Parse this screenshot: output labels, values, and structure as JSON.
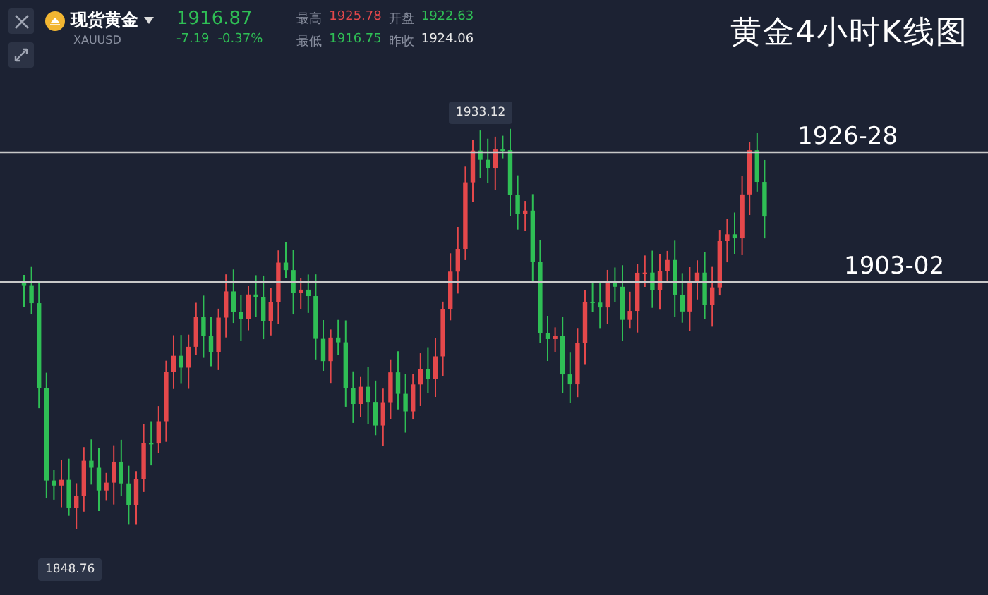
{
  "instrument": {
    "name": "现货黄金",
    "symbol": "XAUUSD",
    "price": "1916.87",
    "change": "-7.19",
    "change_percent": "-0.37%",
    "kind": "down",
    "stats": [
      {
        "label": "最高",
        "value": "1925.78",
        "kind": "up"
      },
      {
        "label": "开盘",
        "value": "1922.63",
        "kind": "down"
      },
      {
        "label": "最低",
        "value": "1916.75",
        "kind": "down"
      },
      {
        "label": "昨收",
        "value": "1924.06",
        "kind": "neutral"
      }
    ]
  },
  "title": "黄金4小时K线图",
  "chart": {
    "high_label": "1933.12",
    "low_label": "1848.76",
    "levels": [
      {
        "label": "1926-28"
      },
      {
        "label": "1903-02"
      }
    ]
  }
}
